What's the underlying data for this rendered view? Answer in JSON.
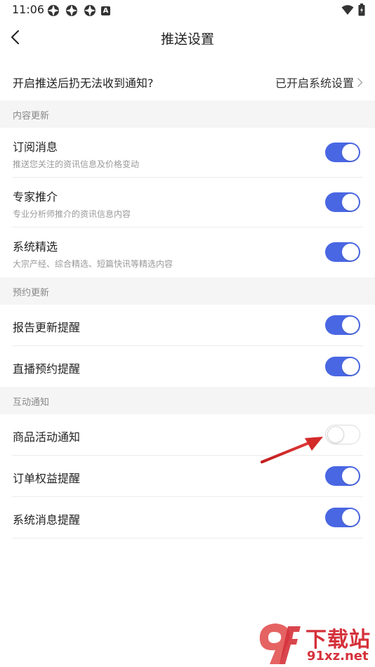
{
  "status_bar": {
    "time": "11:06",
    "indicator": "A"
  },
  "nav": {
    "title": "推送设置"
  },
  "top": {
    "question": "开启推送后扔无法收到通知?",
    "status": "已开启系统设置"
  },
  "sections": [
    {
      "header": "内容更新"
    },
    {
      "header": "预约更新"
    },
    {
      "header": "互动通知"
    }
  ],
  "settings": [
    {
      "label": "订阅消息",
      "desc": "推送您关注的资讯信息及价格变动",
      "enabled": true
    },
    {
      "label": "专家推介",
      "desc": "专业分析师推介的资讯信息内容",
      "enabled": true
    },
    {
      "label": "系统精选",
      "desc": "大宗产经、综合精选、短篇快讯等精选内容",
      "enabled": true
    },
    {
      "label": "报告更新提醒",
      "enabled": true
    },
    {
      "label": "直播预约提醒",
      "enabled": true
    },
    {
      "label": "商品活动通知",
      "enabled": false
    },
    {
      "label": "订单权益提醒",
      "enabled": true
    },
    {
      "label": "系统消息提醒",
      "enabled": true
    }
  ],
  "colors": {
    "accent": "#4a67e3",
    "section_bg": "#f5f5f5",
    "annotation": "#d42a2a"
  },
  "watermark": {
    "title": "下载站",
    "url": "91xz.net",
    "logo": "9f"
  }
}
